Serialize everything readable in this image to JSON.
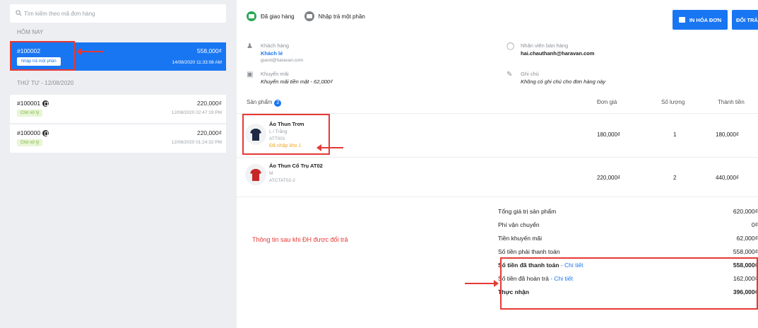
{
  "search": {
    "placeholder": "Tìm kiếm theo mã đơn hàng"
  },
  "groups": {
    "today": "HÔM NAY",
    "wed": "THỨ TƯ - 12/08/2020"
  },
  "orders": [
    {
      "code": "#100002",
      "amount": "558,000₫",
      "date": "14/08/2020 11:33:08 AM",
      "badge": "Nhập trả một phần"
    },
    {
      "code": "#100001",
      "amount": "220,000₫",
      "date": "12/08/2020 02:47:19 PM",
      "badge": "Chờ xử lý"
    },
    {
      "code": "#100000",
      "amount": "220,000₫",
      "date": "12/08/2020 01:24:32 PM",
      "badge": "Chờ xử lý"
    }
  ],
  "status": {
    "delivered": "Đã giao hàng",
    "partial_return": "Nhập trả một phần"
  },
  "buttons": {
    "print": "IN HÓA ĐƠN",
    "exchange": "ĐỔI TRẢ"
  },
  "customer": {
    "label": "Khách hàng",
    "name": "Khách lẻ",
    "email": "guest@haravan.com"
  },
  "staff": {
    "label": "Nhân viên bán hàng",
    "email": "hai.chauthanh@haravan.com"
  },
  "promo": {
    "label": "Khuyến mãi",
    "value": "Khuyến mãi tiền mặt - 62,000₫"
  },
  "note": {
    "label": "Ghi chú",
    "value": "Không có ghi chú cho đơn hàng này"
  },
  "table": {
    "products": "Sản phẩm",
    "count": "2",
    "unit_price": "Đơn giá",
    "qty": "Số lượng",
    "total": "Thành tiền"
  },
  "products": [
    {
      "name": "Áo Thun Trơn",
      "variant": "L / Trắng",
      "sku": "ATT001",
      "note": "Đã nhập kho 1",
      "price": "180,000₫",
      "qty": "1",
      "total": "180,000₫"
    },
    {
      "name": "Áo Thun Cổ Trụ AT02",
      "variant": "M",
      "sku": "ATCTAT02-2",
      "price": "220,000₫",
      "qty": "2",
      "total": "440,000₫"
    }
  ],
  "summary": {
    "subtotal_label": "Tổng giá trị sản phẩm",
    "subtotal": "620,000₫",
    "shipping_label": "Phí vận chuyển",
    "shipping": "0₫",
    "discount_label": "Tiền khuyến mãi",
    "discount": "62,000₫",
    "payable_label": "Số tiền phải thanh toán",
    "payable": "558,000₫",
    "paid_label": "Số tiền đã thanh toán",
    "paid": "558,000₫",
    "refunded_label": "Số tiền đã hoàn trả",
    "refunded": "162,000₫",
    "received_label": "Thực nhận",
    "received": "396,000₫",
    "detail_link": "Chi tiết",
    "dash": " - "
  },
  "annotation": {
    "text": "Thông tin sau khi ĐH được đổi trả"
  },
  "colors": {
    "accent": "#1976f2",
    "highlight": "#e53935",
    "success": "#2aa855"
  }
}
